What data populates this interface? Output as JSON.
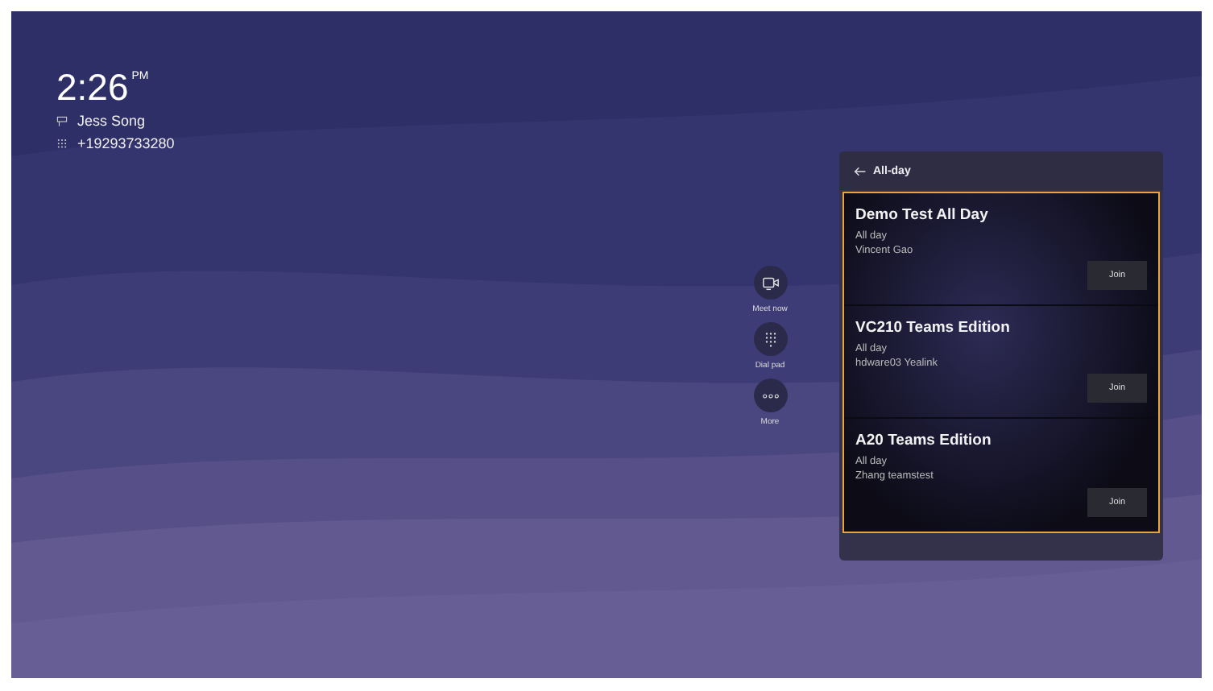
{
  "clock": {
    "time": "2:26",
    "meridiem": "PM"
  },
  "user": {
    "name": "Jess Song",
    "number": "+19293733280"
  },
  "actions": [
    {
      "kind": "meet",
      "label": "Meet now"
    },
    {
      "kind": "dialpad",
      "label": "Dial pad"
    },
    {
      "kind": "more",
      "label": "More"
    }
  ],
  "panel": {
    "title": "All-day",
    "focused": true,
    "meetings": [
      {
        "title": "Demo Test All Day",
        "time": "All day",
        "organizer": "Vincent Gao",
        "button": "Join"
      },
      {
        "title": "VC210 Teams Edition",
        "time": "All day",
        "organizer": "hdware03 Yealink",
        "button": "Join"
      },
      {
        "title": "A20 Teams Edition",
        "time": "All day",
        "organizer": "Zhang teamstest",
        "button": "Join"
      }
    ]
  }
}
